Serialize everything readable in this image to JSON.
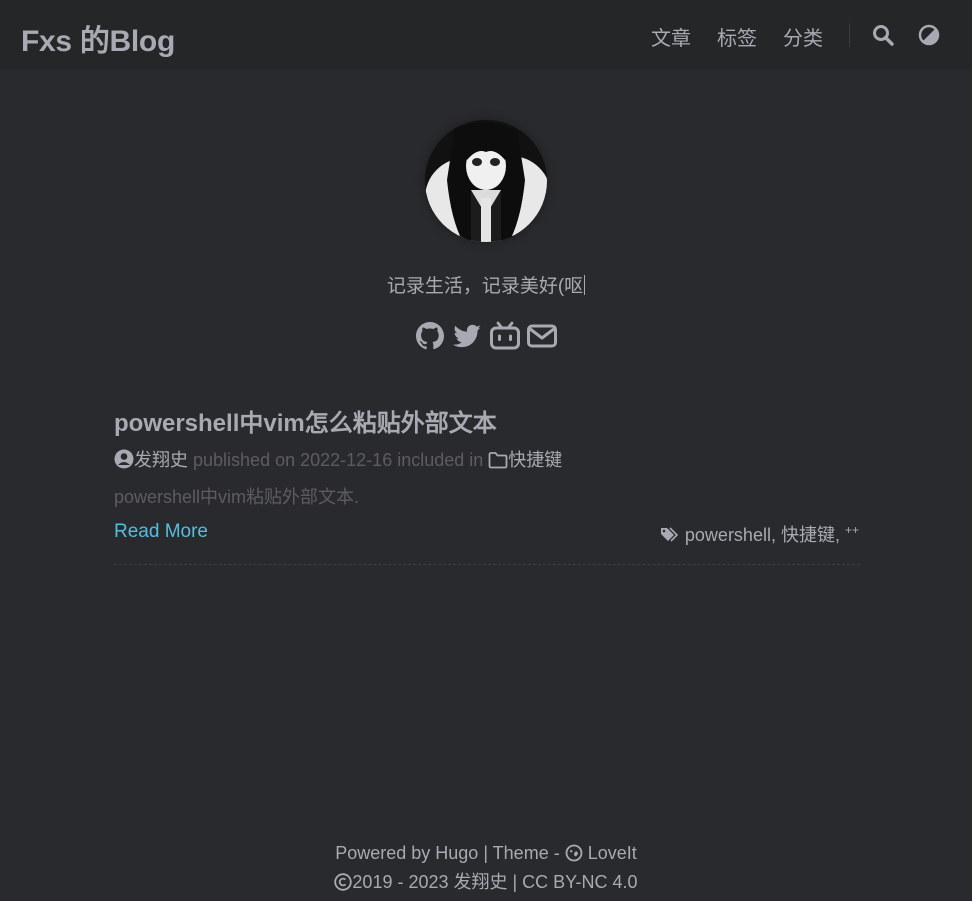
{
  "header": {
    "site_title": "Fxs 的Blog",
    "nav": [
      {
        "label": "文章"
      },
      {
        "label": "标签"
      },
      {
        "label": "分类"
      }
    ],
    "search_icon": "search-icon",
    "theme_icon": "theme-switch-icon"
  },
  "profile": {
    "subtitle": "记录生活，记录美好(呕",
    "social_icons": [
      "github-icon",
      "twitter-icon",
      "bilibili-icon",
      "email-icon"
    ]
  },
  "post": {
    "title": "powershell中vim怎么粘贴外部文本",
    "author": "发翔史",
    "published_prefix": "published on",
    "date": "2022-12-16",
    "included_in": "included in",
    "category": "快捷键",
    "summary": "powershell中vim粘贴外部文本.",
    "read_more": "Read More",
    "tags": [
      "powershell",
      "快捷键",
      "++"
    ]
  },
  "footer": {
    "powered_by": "Powered by",
    "hugo": "Hugo",
    "theme_text": "| Theme -",
    "theme_name": "LoveIt",
    "copyright": "2019 - 2023 发翔史 | CC BY-NC 4.0"
  },
  "colors": {
    "background": "#292a2d",
    "header": "#252627",
    "text": "#a9a9b3",
    "muted": "#5d5d5f",
    "link": "#55bde2"
  }
}
